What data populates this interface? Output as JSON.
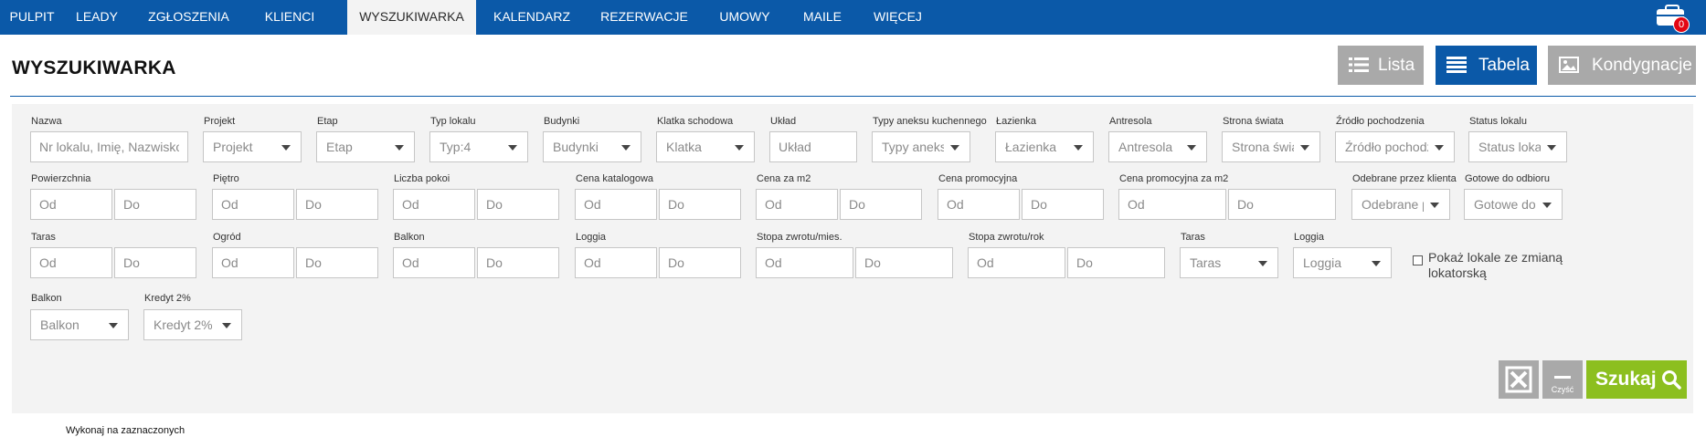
{
  "nav": {
    "items": [
      "PULPIT",
      "LEADY",
      "ZGŁOSZENIA",
      "KLIENCI",
      "WYSZUKIWARKA",
      "KALENDARZ",
      "REZERWACJE",
      "UMOWY",
      "MAILE",
      "WIĘCEJ"
    ],
    "active": "WYSZUKIWARKA",
    "notification_count": "0"
  },
  "page": {
    "title": "WYSZUKIWARKA"
  },
  "view_buttons": {
    "list": "Lista",
    "table": "Tabela",
    "floors": "Kondygnacje"
  },
  "filters": {
    "row1": {
      "nazwa": {
        "label": "Nazwa",
        "placeholder": "Nr lokalu, Imię, Nazwisko"
      },
      "projekt": {
        "label": "Projekt",
        "value": "Projekt"
      },
      "etap": {
        "label": "Etap",
        "value": "Etap"
      },
      "typ_lokalu": {
        "label": "Typ lokalu",
        "value": "Typ:4"
      },
      "budynki": {
        "label": "Budynki",
        "value": "Budynki"
      },
      "klatka": {
        "label": "Klatka schodowa",
        "value": "Klatka"
      },
      "uklad": {
        "label": "Układ",
        "placeholder": "Układ"
      },
      "typy_aneksu": {
        "label": "Typy aneksu kuchennego",
        "value": "Typy aneks"
      },
      "lazienka": {
        "label": "Łazienka",
        "value": "Łazienka"
      },
      "antresola": {
        "label": "Antresola",
        "value": "Antresola"
      },
      "strona_swiata": {
        "label": "Strona świata",
        "value": "Strona świa"
      },
      "zrodlo": {
        "label": "Źródło pochodzenia",
        "value": "Źródło pochodz"
      },
      "status": {
        "label": "Status lokalu",
        "value": "Status lokal"
      }
    },
    "row2": {
      "powierzchnia": {
        "label": "Powierzchnia",
        "from": "Od",
        "to": "Do"
      },
      "pietro": {
        "label": "Piętro",
        "from": "Od",
        "to": "Do"
      },
      "liczba_pokoi": {
        "label": "Liczba pokoi",
        "from": "Od",
        "to": "Do"
      },
      "cena_katalogowa": {
        "label": "Cena katalogowa",
        "from": "Od",
        "to": "Do"
      },
      "cena_m2": {
        "label": "Cena za m2",
        "from": "Od",
        "to": "Do"
      },
      "cena_promocyjna": {
        "label": "Cena promocyjna",
        "from": "Od",
        "to": "Do"
      },
      "cena_promocyjna_m2": {
        "label": "Cena promocyjna za m2",
        "from": "Od",
        "to": "Do"
      },
      "odebrane": {
        "label": "Odebrane przez klienta",
        "value": "Odebrane p"
      },
      "gotowe": {
        "label": "Gotowe do odbioru",
        "value": "Gotowe do"
      }
    },
    "row3": {
      "taras": {
        "label": "Taras",
        "from": "Od",
        "to": "Do"
      },
      "ogrod": {
        "label": "Ogród",
        "from": "Od",
        "to": "Do"
      },
      "balkon": {
        "label": "Balkon",
        "from": "Od",
        "to": "Do"
      },
      "loggia": {
        "label": "Loggia",
        "from": "Od",
        "to": "Do"
      },
      "stopa_mies": {
        "label": "Stopa zwrotu/mies.",
        "from": "Od",
        "to": "Do"
      },
      "stopa_rok": {
        "label": "Stopa zwrotu/rok",
        "from": "Od",
        "to": "Do"
      },
      "taras_sel": {
        "label": "Taras",
        "value": "Taras"
      },
      "loggia_sel": {
        "label": "Loggia",
        "value": "Loggia"
      },
      "pokaz_lokale": {
        "label": "Pokaż lokale ze zmianą lokatorską",
        "checked": false
      }
    },
    "row4": {
      "balkon_sel": {
        "label": "Balkon",
        "value": "Balkon"
      },
      "kredyt": {
        "label": "Kredyt 2%",
        "value": "Kredyt 2%"
      }
    }
  },
  "actions": {
    "clear_label": "Czyść",
    "search_label": "Szukaj"
  },
  "footer": {
    "bulk_action": "Wykonaj na zaznaczonych"
  },
  "colors": {
    "nav_bg": "#0b59a8",
    "accent_green": "#8cbf1f",
    "btn_grey": "#a9a9a9",
    "badge_red": "#e30613"
  }
}
